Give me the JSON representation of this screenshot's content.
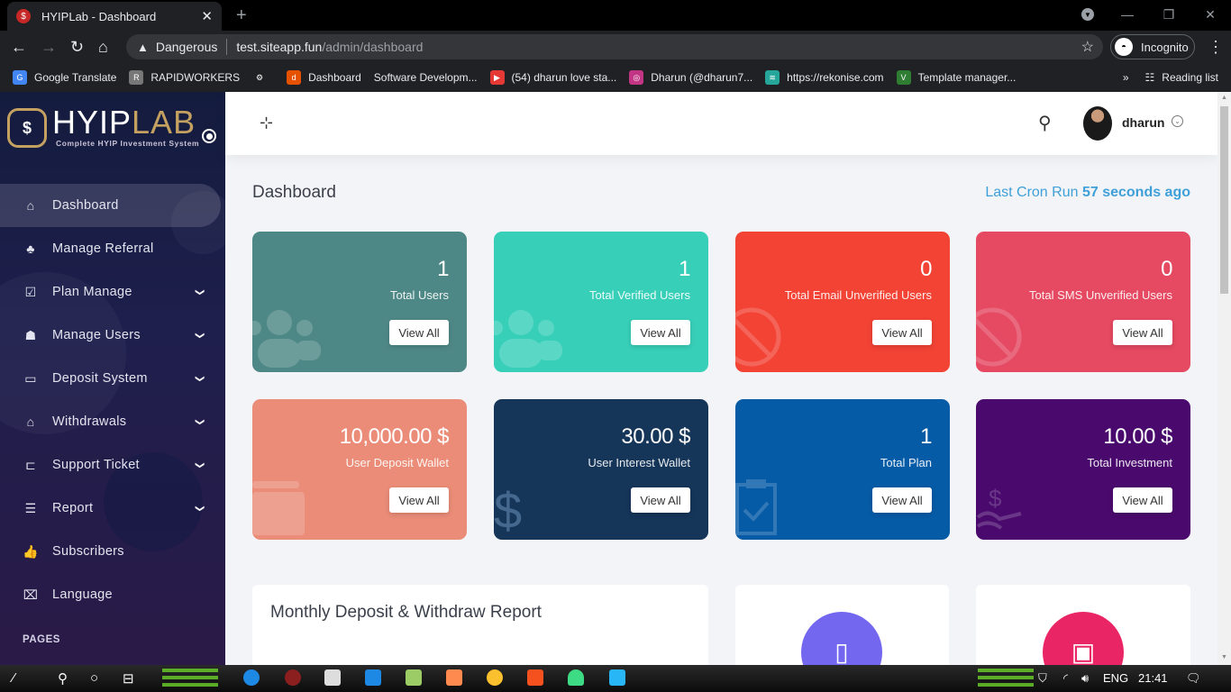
{
  "browser": {
    "tab_title": "HYIPLab - Dashboard",
    "tab_close": "✕",
    "new_tab": "+",
    "security_label": "Dangerous",
    "url_domain": "test.siteapp.fun",
    "url_path": "/admin/dashboard",
    "profile_label": "Incognito",
    "bookmarks": [
      {
        "label": "Google Translate",
        "color": "#4285f4",
        "glyph": "G"
      },
      {
        "label": "RAPIDWORKERS",
        "color": "#777777",
        "glyph": "R"
      },
      {
        "label": "",
        "color": "#ffffff",
        "glyph": "⚙"
      },
      {
        "label": "Dashboard",
        "color": "#e65100",
        "glyph": "d"
      },
      {
        "label": "Software Developm...",
        "color": "",
        "glyph": ""
      },
      {
        "label": "(54) dharun love sta...",
        "color": "#e53935",
        "glyph": "▶"
      },
      {
        "label": "Dharun (@dharun7...",
        "color": "#c13584",
        "glyph": "◎"
      },
      {
        "label": "https://rekonise.com",
        "color": "#26a69a",
        "glyph": "≋"
      },
      {
        "label": "Template manager...",
        "color": "#2e7d32",
        "glyph": "V"
      }
    ],
    "bookmarks_overflow": "»",
    "reading_list": "Reading list"
  },
  "sidebar": {
    "logo_main": "HYIP",
    "logo_accent": "LAB",
    "logo_tagline": "Complete HYIP Investment System",
    "items": [
      {
        "label": "Dashboard",
        "icon": "home-icon",
        "glyph": "⌂",
        "active": true,
        "submenu": false
      },
      {
        "label": "Manage Referral",
        "icon": "tree-icon",
        "glyph": "♣",
        "active": false,
        "submenu": false
      },
      {
        "label": "Plan Manage",
        "icon": "clipboard-check-icon",
        "glyph": "☑",
        "active": false,
        "submenu": true
      },
      {
        "label": "Manage Users",
        "icon": "users-icon",
        "glyph": "☗",
        "active": false,
        "submenu": true
      },
      {
        "label": "Deposit System",
        "icon": "credit-card-icon",
        "glyph": "▭",
        "active": false,
        "submenu": true
      },
      {
        "label": "Withdrawals",
        "icon": "bank-icon",
        "glyph": "⌂",
        "active": false,
        "submenu": true
      },
      {
        "label": "Support Ticket",
        "icon": "ticket-icon",
        "glyph": "⊏",
        "active": false,
        "submenu": true
      },
      {
        "label": "Report",
        "icon": "list-icon",
        "glyph": "☰",
        "active": false,
        "submenu": true
      },
      {
        "label": "Subscribers",
        "icon": "thumbs-up-icon",
        "glyph": "👍",
        "active": false,
        "submenu": false
      },
      {
        "label": "Language",
        "icon": "language-icon",
        "glyph": "⌧",
        "active": false,
        "submenu": false
      }
    ],
    "section_header": "PAGES",
    "chevron": "⌄"
  },
  "topbar": {
    "username": "dharun"
  },
  "main": {
    "page_title": "Dashboard",
    "cron_label": "Last Cron Run",
    "cron_value": "57 seconds ago",
    "cards": [
      {
        "value": "1",
        "label": "Total Users",
        "button": "View All",
        "color": "#4e8886",
        "icon": "users-icon"
      },
      {
        "value": "1",
        "label": "Total Verified Users",
        "button": "View All",
        "color": "#38cfb9",
        "icon": "users-icon"
      },
      {
        "value": "0",
        "label": "Total Email Unverified Users",
        "button": "View All",
        "color": "#f24335",
        "icon": "ban-icon"
      },
      {
        "value": "0",
        "label": "Total SMS Unverified Users",
        "button": "View All",
        "color": "#e54a62",
        "icon": "ban-icon"
      },
      {
        "value": "10,000.00 $",
        "label": "User Deposit Wallet",
        "button": "View All",
        "color": "#ea8c77",
        "icon": "wallet-icon"
      },
      {
        "value": "30.00 $",
        "label": "User Interest Wallet",
        "button": "View All",
        "color": "#153559",
        "icon": "dollar-icon"
      },
      {
        "value": "1",
        "label": "Total Plan",
        "button": "View All",
        "color": "#065ba6",
        "icon": "clipboard-check-icon"
      },
      {
        "value": "10.00 $",
        "label": "Total Investment",
        "button": "View All",
        "color": "#4a0a6d",
        "icon": "hand-dollar-icon"
      }
    ],
    "report_title": "Monthly Deposit & Withdraw Report",
    "widget_colors": [
      "#7367f0",
      "#ea2566"
    ]
  },
  "taskbar": {
    "language": "ENG",
    "time": "21:41"
  }
}
